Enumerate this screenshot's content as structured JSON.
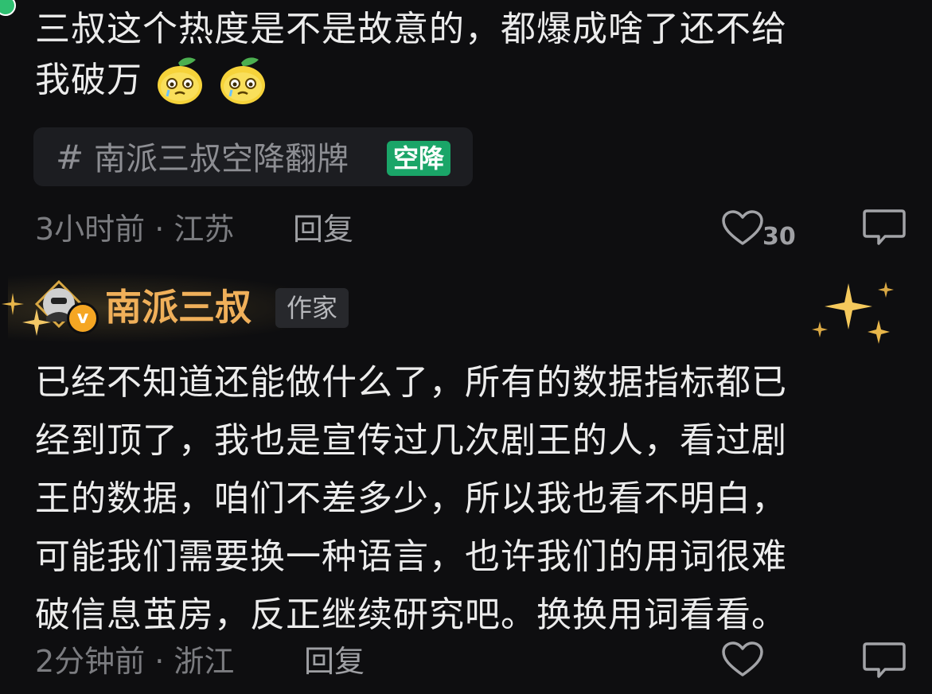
{
  "comment1": {
    "line1": "三叔这个热度是不是故意的，都爆成啥了还不给",
    "line2": "我破万",
    "emojis": [
      "crying-lemon-icon",
      "crying-lemon-icon"
    ],
    "topic_hash": "#",
    "topic_label": "南派三叔空降翻牌",
    "topic_badge": "空降",
    "time_location": "3小时前 · 江苏",
    "reply_label": "回复",
    "like_count": "30"
  },
  "reply": {
    "author": "南派三叔",
    "author_badge": "作家",
    "verified_mark": "v",
    "lines": [
      "已经不知道还能做什么了，所有的数据指标都已",
      "经到顶了，我也是宣传过几次剧王的人，看过剧",
      "王的数据，咱们不差多少，所以我也看不明白，",
      "可能我们需要换一种语言，也许我们的用词很难",
      "破信息茧房，反正继续研究吧。换换用词看看。"
    ],
    "time_location": "2分钟前 · 浙江",
    "reply_label": "回复"
  },
  "colors": {
    "background": "#0e0e10",
    "author_gold": "#f0b05a",
    "topic_badge_green": "#1aa568"
  }
}
